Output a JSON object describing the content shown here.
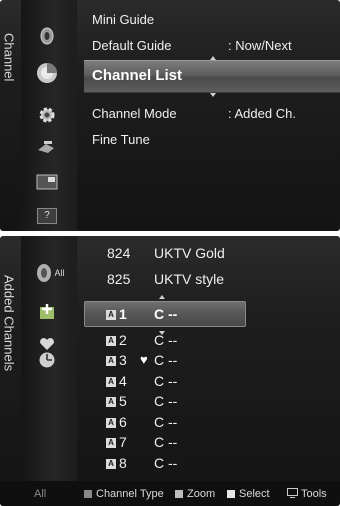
{
  "top_menu": {
    "side_label": "Channel",
    "items": [
      {
        "label": "Mini Guide",
        "value": ""
      },
      {
        "label": "Default Guide",
        "value": ": Now/Next"
      },
      {
        "label": "Channel List",
        "value": ""
      },
      {
        "label": "Channel Mode",
        "value": ": Added Ch."
      },
      {
        "label": "Fine Tune",
        "value": ""
      }
    ],
    "selected_index": 2,
    "icons": [
      "input-icon",
      "channel-icon",
      "settings-gear-icon",
      "satellite-icon",
      "picture-in-picture-icon",
      "help-icon"
    ],
    "help_icon_label": "?"
  },
  "bottom_list": {
    "side_label": "Added Channels",
    "left_icon_label": "All",
    "channels": [
      {
        "num": "824",
        "name": "UKTV Gold",
        "badge": "",
        "heart": ""
      },
      {
        "num": "825",
        "name": "UKTV style",
        "badge": "",
        "heart": ""
      },
      {
        "num": "1",
        "name": "C --",
        "badge": "A",
        "heart": ""
      },
      {
        "num": "2",
        "name": "C --",
        "badge": "A",
        "heart": ""
      },
      {
        "num": "3",
        "name": "C --",
        "badge": "A",
        "heart": "♥"
      },
      {
        "num": "4",
        "name": "C --",
        "badge": "A",
        "heart": ""
      },
      {
        "num": "5",
        "name": "C --",
        "badge": "A",
        "heart": ""
      },
      {
        "num": "6",
        "name": "C --",
        "badge": "A",
        "heart": ""
      },
      {
        "num": "7",
        "name": "C --",
        "badge": "A",
        "heart": ""
      },
      {
        "num": "8",
        "name": "C --",
        "badge": "A",
        "heart": ""
      }
    ],
    "selected_index": 2
  },
  "footer": {
    "all": "All",
    "channel_type": "Channel Type",
    "zoom": "Zoom",
    "select": "Select",
    "tools": "Tools",
    "colors": {
      "channel_type": "#8a8a8a",
      "zoom": "#bdbdbd",
      "select": "#e6e6e6"
    }
  }
}
